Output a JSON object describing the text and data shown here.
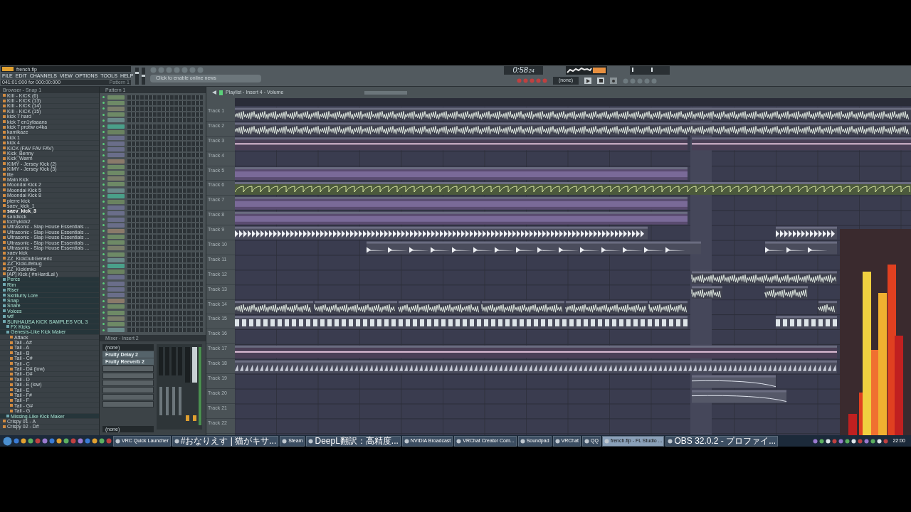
{
  "window": {
    "title": "french.flp"
  },
  "menu": [
    "FILE",
    "EDIT",
    "CHANNELS",
    "VIEW",
    "OPTIONS",
    "TOOLS",
    "HELP"
  ],
  "hint_bar": {
    "position": "041:01:000 for 000:00:000",
    "pattern": "Pattern 1"
  },
  "news": {
    "label": "Click to enable online news"
  },
  "master_volume": {
    "level": 0.7
  },
  "master_pitch": {
    "level": 0.5
  },
  "mixer": {
    "title": "Mixer - Insert 2",
    "input": "(none)",
    "slots": [
      "Fruity Delay 2",
      "Fruity Reeverb 2"
    ],
    "output": "(none)"
  },
  "transport": {
    "time": "0:58",
    "time_small": "24",
    "pattern_selector": "(none)"
  },
  "browser": {
    "title": "Browser - Snap 1",
    "items": [
      {
        "label": "KIII - KICK (6)",
        "kind": "file",
        "selected": false
      },
      {
        "label": "KIII - KICK (13)",
        "kind": "file",
        "selected": false
      },
      {
        "label": "KIII - KICK (14)",
        "kind": "file",
        "selected": false
      },
      {
        "label": "KIII - KICK (15)",
        "kind": "file",
        "selected": false
      },
      {
        "label": "kick 7 hard",
        "kind": "file",
        "selected": false
      },
      {
        "label": "kick 7 en1yfaaans",
        "kind": "file",
        "selected": false
      },
      {
        "label": "kick 7 probw o4ka",
        "kind": "file",
        "selected": false
      },
      {
        "label": "kamikaze",
        "kind": "file",
        "selected": false
      },
      {
        "label": "kick 1",
        "kind": "file",
        "selected": false
      },
      {
        "label": "kick 4",
        "kind": "file",
        "selected": false
      },
      {
        "label": "KICK (FAV FAV FAV)",
        "kind": "file",
        "selected": false
      },
      {
        "label": "Kick_Benny",
        "kind": "file",
        "selected": false
      },
      {
        "label": "Kick_Warm",
        "kind": "file",
        "selected": false
      },
      {
        "label": "KIMY - Jersey Kick (2)",
        "kind": "file",
        "selected": false
      },
      {
        "label": "KIMY - Jersey Kick (3)",
        "kind": "file",
        "selected": false
      },
      {
        "label": "lite",
        "kind": "file",
        "selected": false
      },
      {
        "label": "Main Kick",
        "kind": "file",
        "selected": false
      },
      {
        "label": "Moondai Kick 2",
        "kind": "file",
        "selected": false
      },
      {
        "label": "Moondai Kick 5",
        "kind": "file",
        "selected": false
      },
      {
        "label": "Moondai Kick 8",
        "kind": "file",
        "selected": false
      },
      {
        "label": "pierre kick",
        "kind": "file",
        "selected": false
      },
      {
        "label": "saev_kick_1",
        "kind": "file",
        "selected": false
      },
      {
        "label": "saev_kick_3",
        "kind": "file",
        "selected": true
      },
      {
        "label": "sandkick",
        "kind": "file",
        "selected": false
      },
      {
        "label": "tochykick2",
        "kind": "file",
        "selected": false
      },
      {
        "label": "Ultrasonic - Slap House Essentials ...",
        "kind": "file",
        "selected": false
      },
      {
        "label": "Ultrasonic - Slap House Essentials ...",
        "kind": "file",
        "selected": false
      },
      {
        "label": "Ultrasonic - Slap House Essentials ...",
        "kind": "file",
        "selected": false
      },
      {
        "label": "Ultrasonic - Slap House Essentials ...",
        "kind": "file",
        "selected": false
      },
      {
        "label": "Ultrasonic - Slap House Essentials ...",
        "kind": "file",
        "selected": false
      },
      {
        "label": "xaev kick",
        "kind": "file",
        "selected": false
      },
      {
        "label": "ZZ_KickDubGeneric",
        "kind": "file",
        "selected": false
      },
      {
        "label": "ZZ_KickLifebug",
        "kind": "file",
        "selected": false
      },
      {
        "label": "ZZ_KickImko",
        "kind": "file",
        "selected": false
      },
      {
        "label": "[AP] Kick ( #nHardLal )",
        "kind": "file",
        "selected": false
      },
      {
        "label": "Percs",
        "kind": "folder",
        "selected": false
      },
      {
        "label": "Rim",
        "kind": "folder",
        "selected": false
      },
      {
        "label": "Riser",
        "kind": "folder",
        "selected": false
      },
      {
        "label": "Skrillurry Lore",
        "kind": "folder",
        "selected": false
      },
      {
        "label": "Snap",
        "kind": "folder",
        "selected": false
      },
      {
        "label": "Snare",
        "kind": "folder",
        "selected": false
      },
      {
        "label": "Voices",
        "kind": "folder",
        "selected": false
      },
      {
        "label": "wtf",
        "kind": "folder",
        "selected": false
      },
      {
        "label": "SUNHAUSA KICK SAMPLES VOL 3",
        "kind": "folder",
        "selected": false,
        "children": [
          {
            "label": "FX Kicks",
            "kind": "folder",
            "selected": false
          },
          {
            "label": "Genesis-Like Kick Maker",
            "kind": "folder",
            "selected": false,
            "children": [
              {
                "label": "Attack",
                "kind": "file",
                "selected": false
              },
              {
                "label": "Tail - A#",
                "kind": "file",
                "selected": false
              },
              {
                "label": "Tail - A",
                "kind": "file",
                "selected": false
              },
              {
                "label": "Tail - B",
                "kind": "file",
                "selected": false
              },
              {
                "label": "Tail - C#",
                "kind": "file",
                "selected": false
              },
              {
                "label": "Tail - C",
                "kind": "file",
                "selected": false
              },
              {
                "label": "Tail - D# (low)",
                "kind": "file",
                "selected": false
              },
              {
                "label": "Tail - D#",
                "kind": "file",
                "selected": false
              },
              {
                "label": "Tail - D",
                "kind": "file",
                "selected": false
              },
              {
                "label": "Tail - E (low)",
                "kind": "file",
                "selected": false
              },
              {
                "label": "Tail - E",
                "kind": "file",
                "selected": false
              },
              {
                "label": "Tail - F#",
                "kind": "file",
                "selected": false
              },
              {
                "label": "Tail - F",
                "kind": "file",
                "selected": false
              },
              {
                "label": "Tail - G#",
                "kind": "file",
                "selected": false
              },
              {
                "label": "Tail - G",
                "kind": "file",
                "selected": false
              }
            ]
          },
          {
            "label": "Missing-Like Kick Maker",
            "kind": "folder",
            "selected": false
          }
        ]
      },
      {
        "label": "Crispy 01 - A",
        "kind": "file",
        "selected": false
      },
      {
        "label": "Crispy 02 - D#",
        "kind": "file",
        "selected": false
      }
    ]
  },
  "channel_rack": {
    "title": "Pattern 1"
  },
  "playlist": {
    "title": "Playlist - Insert 4 - Volume",
    "tracks": [
      "Track 1",
      "Track 2",
      "Track 3",
      "Track 4",
      "Track 5",
      "Track 6",
      "Track 7",
      "Track 8",
      "Track 9",
      "Track 10",
      "Track 11",
      "Track 12",
      "Track 13",
      "Track 14",
      "Track 15",
      "Track 16",
      "Track 17",
      "Track 18",
      "Track 19",
      "Track 20",
      "Track 21",
      "Track 22"
    ]
  },
  "taskbar": {
    "windows": [
      {
        "label": "VRC Quick Launcher",
        "selected": false
      },
      {
        "label": "#おなりえす | 猫がキサ...",
        "selected": false
      },
      {
        "label": "Steam",
        "selected": false
      },
      {
        "label": "DeepL翻訳：高精度...",
        "selected": false
      },
      {
        "label": "NVIDIA Broadcast",
        "selected": false
      },
      {
        "label": "VRChat Creator Com...",
        "selected": false
      },
      {
        "label": "Soundpad",
        "selected": false
      },
      {
        "label": "VRChat",
        "selected": false
      },
      {
        "label": "QQ",
        "selected": false
      },
      {
        "label": "french.flp - FL Studio ...",
        "selected": true
      },
      {
        "label": "OBS 32.0.2 - プロファイ...",
        "selected": false
      }
    ],
    "clock": "22:00"
  }
}
